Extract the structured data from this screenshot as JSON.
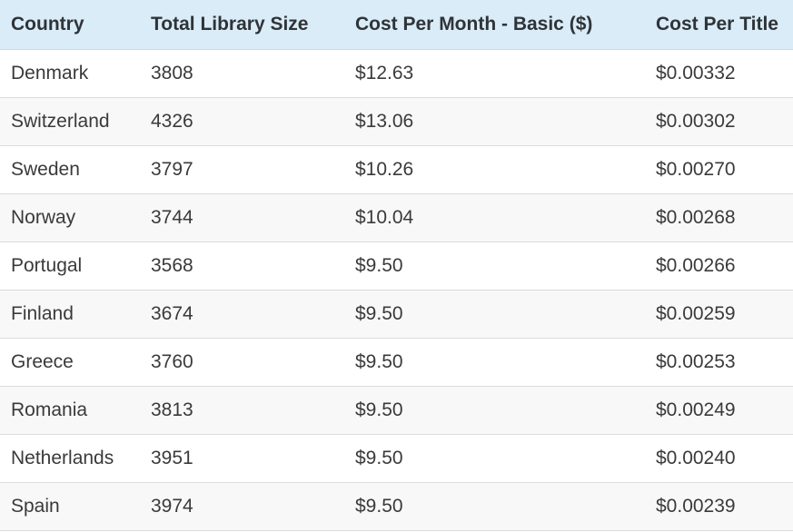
{
  "chart_data": {
    "type": "table",
    "columns": [
      "Country",
      "Total Library Size",
      "Cost Per Month - Basic ($)",
      "Cost Per Title"
    ],
    "rows": [
      [
        "Denmark",
        "3808",
        "$12.63",
        "$0.00332"
      ],
      [
        "Switzerland",
        "4326",
        "$13.06",
        "$0.00302"
      ],
      [
        "Sweden",
        "3797",
        "$10.26",
        "$0.00270"
      ],
      [
        "Norway",
        "3744",
        "$10.04",
        "$0.00268"
      ],
      [
        "Portugal",
        "3568",
        "$9.50",
        "$0.00266"
      ],
      [
        "Finland",
        "3674",
        "$9.50",
        "$0.00259"
      ],
      [
        "Greece",
        "3760",
        "$9.50",
        "$0.00253"
      ],
      [
        "Romania",
        "3813",
        "$9.50",
        "$0.00249"
      ],
      [
        "Netherlands",
        "3951",
        "$9.50",
        "$0.00240"
      ],
      [
        "Spain",
        "3974",
        "$9.50",
        "$0.00239"
      ]
    ]
  },
  "colors": {
    "header_bg": "#d9ecf7",
    "row_alt_bg": "#f8f8f8",
    "text": "#3a3a3a"
  }
}
